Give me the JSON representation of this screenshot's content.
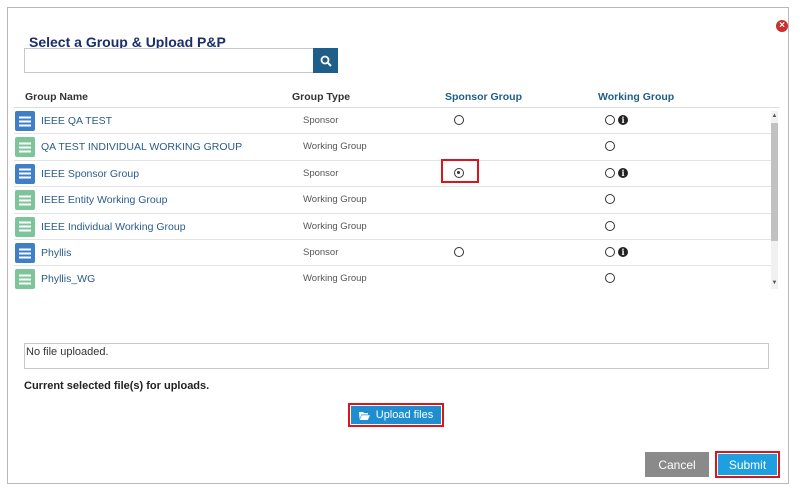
{
  "dialog": {
    "title": "Select a Group & Upload P&P",
    "close_icon": "close-icon"
  },
  "search": {
    "value": "",
    "placeholder": "",
    "button_icon": "search-icon"
  },
  "table": {
    "headers": {
      "group_name": "Group Name",
      "group_type": "Group Type",
      "sponsor_group": "Sponsor Group",
      "working_group": "Working Group"
    },
    "rows": [
      {
        "name": "IEEE QA TEST",
        "type": "Sponsor",
        "sponsor_radio": true,
        "sponsor_checked": false,
        "working_radio": true,
        "info": true
      },
      {
        "name": "QA TEST INDIVIDUAL WORKING GROUP",
        "type": "Working Group",
        "sponsor_radio": false,
        "sponsor_checked": false,
        "working_radio": true,
        "info": false
      },
      {
        "name": "IEEE Sponsor Group",
        "type": "Sponsor",
        "sponsor_radio": true,
        "sponsor_checked": true,
        "working_radio": true,
        "info": true
      },
      {
        "name": "IEEE Entity Working Group",
        "type": "Working Group",
        "sponsor_radio": false,
        "sponsor_checked": false,
        "working_radio": true,
        "info": false
      },
      {
        "name": "IEEE Individual Working Group",
        "type": "Working Group",
        "sponsor_radio": false,
        "sponsor_checked": false,
        "working_radio": true,
        "info": false
      },
      {
        "name": "Phyllis",
        "type": "Sponsor",
        "sponsor_radio": true,
        "sponsor_checked": false,
        "working_radio": true,
        "info": true
      },
      {
        "name": "Phyllis_WG",
        "type": "Working Group",
        "sponsor_radio": false,
        "sponsor_checked": false,
        "working_radio": true,
        "info": false
      }
    ]
  },
  "upload": {
    "file_status": "No file uploaded.",
    "current_label": "Current selected file(s) for uploads.",
    "upload_label": "Upload files",
    "upload_icon": "folder-open-icon"
  },
  "footer": {
    "cancel_label": "Cancel",
    "submit_label": "Submit"
  },
  "colors": {
    "accent": "#1f8ed1",
    "title": "#1a2e6e",
    "sponsor_icon": "#3f7fc4",
    "working_icon": "#7dc49a",
    "highlight": "#d9161c",
    "cancel": "#8a8a8a"
  }
}
